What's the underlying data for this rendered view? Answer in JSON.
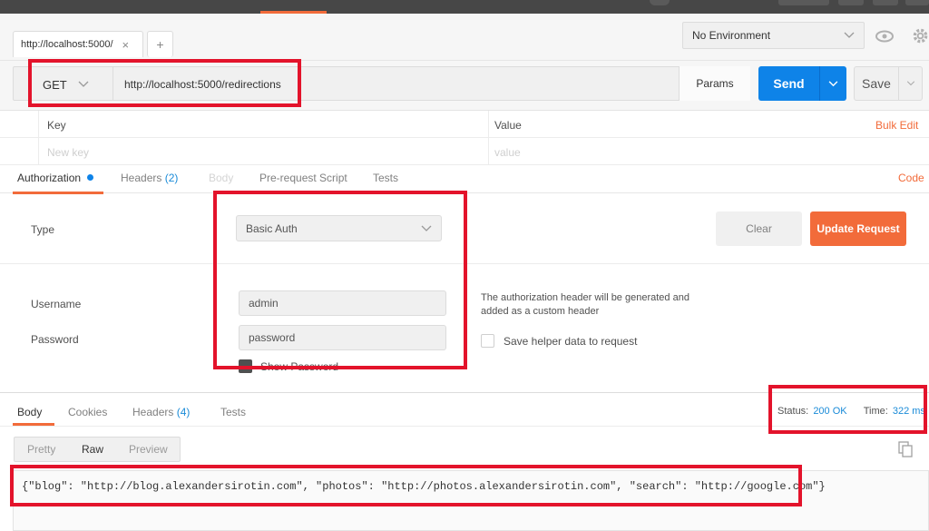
{
  "window": {
    "tab_label": "http://localhost:5000/",
    "tab_close": "×",
    "new_tab": "+"
  },
  "environment": {
    "selected": "No Environment",
    "chevron": "⌵"
  },
  "request": {
    "method": "GET",
    "url": "http://localhost:5000/redirections",
    "params_label": "Params",
    "send_label": "Send",
    "save_label": "Save"
  },
  "params_table": {
    "columns": [
      "Key",
      "Value"
    ],
    "bulk_edit": "Bulk Edit",
    "placeholder_key": "New key",
    "placeholder_value": "value"
  },
  "request_tabs": {
    "authorization": "Authorization",
    "headers": "Headers",
    "headers_count": "(2)",
    "body": "Body",
    "prerequest": "Pre-request Script",
    "tests": "Tests",
    "code": "Code"
  },
  "auth": {
    "type_label": "Type",
    "type_value": "Basic Auth",
    "clear_label": "Clear",
    "update_label": "Update Request",
    "username_label": "Username",
    "username_value": "admin",
    "password_label": "Password",
    "password_value": "password",
    "hint_line1": "The authorization header will be generated and",
    "hint_line2": "added as a custom header",
    "save_helper": "Save helper data to request",
    "show_password": "Show Password"
  },
  "response": {
    "tabs": {
      "body": "Body",
      "cookies": "Cookies",
      "headers": "Headers",
      "headers_count": "(4)",
      "tests": "Tests"
    },
    "status_label": "Status:",
    "status_value": "200 OK",
    "time_label": "Time:",
    "time_value": "322 ms",
    "views": [
      "Pretty",
      "Raw",
      "Preview"
    ],
    "body_text": "{\"blog\": \"http://blog.alexandersirotin.com\", \"photos\": \"http://photos.alexandersirotin.com\", \"search\": \"http://google.com\"}"
  },
  "colors": {
    "accent": "#f26b3a",
    "send_blue": "#0e83e8",
    "status_blue": "#1a8bd8",
    "annotation_red": "#e3132b"
  }
}
